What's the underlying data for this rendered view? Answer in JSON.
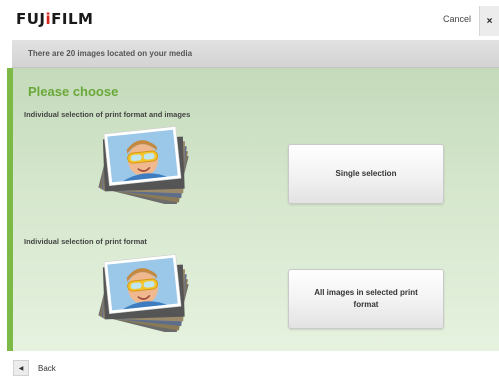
{
  "header": {
    "logo_main": "FUJ",
    "logo_mark": "i",
    "logo_end": "FILM",
    "cancel_label": "Cancel",
    "close_glyph": "×"
  },
  "info": {
    "message": "There are 20 images located on your media"
  },
  "main": {
    "heading": "Please choose",
    "options": [
      {
        "label": "Individual selection of print format and images",
        "button_label": "Single selection",
        "image_icon": "photo-stack-icon"
      },
      {
        "label": "Individual selection of print format",
        "button_label": "All images in selected print format",
        "image_icon": "photo-stack-icon"
      }
    ]
  },
  "footer": {
    "back_glyph": "◀",
    "back_label": "Back"
  },
  "colors": {
    "accent_green": "#7db946",
    "heading_green": "#6aa83a",
    "logo_red": "#d7261e",
    "panel_top": "#c4daba",
    "panel_bottom": "#e6f2df"
  }
}
